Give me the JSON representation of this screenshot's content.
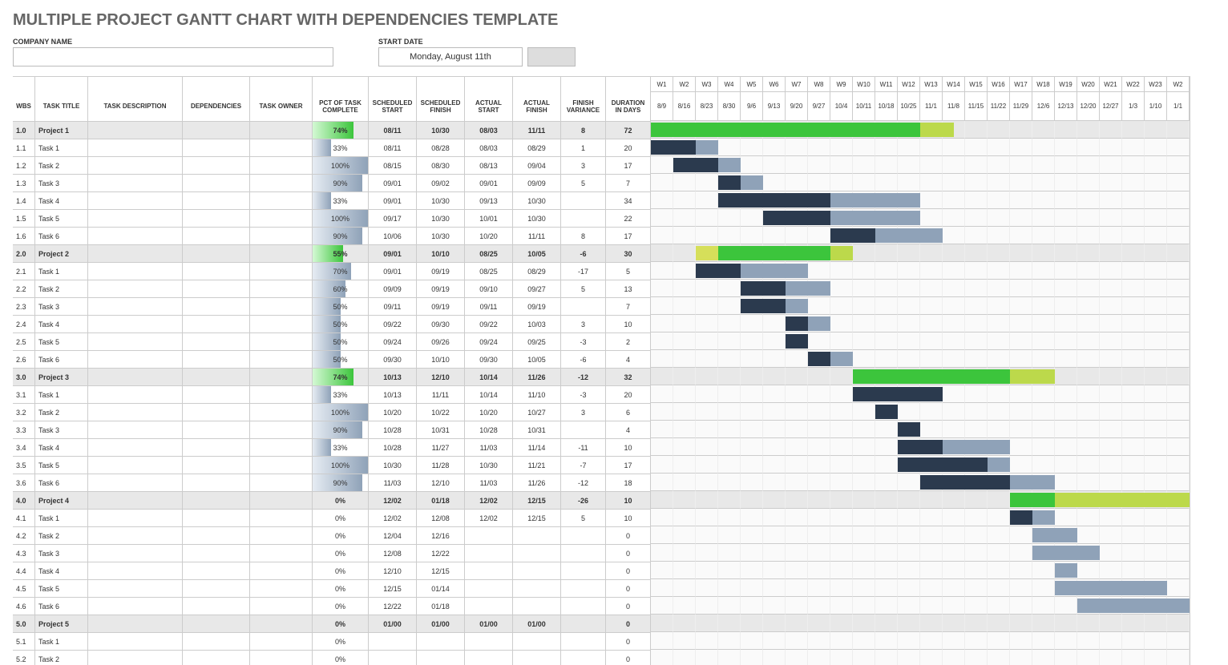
{
  "title": "MULTIPLE PROJECT GANTT CHART WITH DEPENDENCIES TEMPLATE",
  "form": {
    "company_label": "COMPANY NAME",
    "start_date_label": "START DATE",
    "start_date_value": "Monday, August 11th",
    "company_value": ""
  },
  "headers": {
    "wbs": "WBS",
    "title": "TASK TITLE",
    "desc": "TASK DESCRIPTION",
    "dep": "DEPENDENCIES",
    "owner": "TASK OWNER",
    "pct": "PCT OF TASK COMPLETE",
    "sstart": "SCHEDULED START",
    "sfinish": "SCHEDULED FINISH",
    "astart": "ACTUAL START",
    "afinish": "ACTUAL FINISH",
    "var": "FINISH VARIANCE",
    "dur": "DURATION IN DAYS"
  },
  "weeks": [
    "W1",
    "W2",
    "W3",
    "W4",
    "W5",
    "W6",
    "W7",
    "W8",
    "W9",
    "W10",
    "W11",
    "W12",
    "W13",
    "W14",
    "W15",
    "W16",
    "W17",
    "W18",
    "W19",
    "W20",
    "W21",
    "W22",
    "W23",
    "W2"
  ],
  "dates": [
    "8/9",
    "8/16",
    "8/23",
    "8/30",
    "9/6",
    "9/13",
    "9/20",
    "9/27",
    "10/4",
    "10/11",
    "10/18",
    "10/25",
    "11/1",
    "11/8",
    "11/15",
    "11/22",
    "11/29",
    "12/6",
    "12/13",
    "12/20",
    "12/27",
    "1/3",
    "1/10",
    "1/1"
  ],
  "rows": [
    {
      "wbs": "1.0",
      "title": "Project 1",
      "proj": true,
      "pct": "74%",
      "pctv": 74,
      "ss": "08/11",
      "sf": "10/30",
      "as": "08/03",
      "af": "11/11",
      "var": "8",
      "dur": "72",
      "bar": [
        0,
        12,
        1.5,
        "proj"
      ]
    },
    {
      "wbs": "1.1",
      "title": "Task 1",
      "pct": "33%",
      "pctv": 33,
      "ss": "08/11",
      "sf": "08/28",
      "as": "08/03",
      "af": "08/29",
      "var": "1",
      "dur": "20",
      "bar": [
        0,
        2,
        1,
        "task"
      ]
    },
    {
      "wbs": "1.2",
      "title": "Task 2",
      "pct": "100%",
      "pctv": 100,
      "ss": "08/15",
      "sf": "08/30",
      "as": "08/13",
      "af": "09/04",
      "var": "3",
      "dur": "17",
      "bar": [
        1,
        2,
        1,
        "task"
      ]
    },
    {
      "wbs": "1.3",
      "title": "Task 3",
      "pct": "90%",
      "pctv": 90,
      "ss": "09/01",
      "sf": "09/02",
      "as": "09/01",
      "af": "09/09",
      "var": "5",
      "dur": "7",
      "bar": [
        3,
        1,
        1,
        "task"
      ]
    },
    {
      "wbs": "1.4",
      "title": "Task 4",
      "pct": "33%",
      "pctv": 33,
      "ss": "09/01",
      "sf": "10/30",
      "as": "09/13",
      "af": "10/30",
      "var": "",
      "dur": "34",
      "bar": [
        3,
        5,
        4,
        "task"
      ]
    },
    {
      "wbs": "1.5",
      "title": "Task 5",
      "pct": "100%",
      "pctv": 100,
      "ss": "09/17",
      "sf": "10/30",
      "as": "10/01",
      "af": "10/30",
      "var": "",
      "dur": "22",
      "bar": [
        5,
        3,
        4,
        "task"
      ]
    },
    {
      "wbs": "1.6",
      "title": "Task 6",
      "pct": "90%",
      "pctv": 90,
      "ss": "10/06",
      "sf": "10/30",
      "as": "10/20",
      "af": "11/11",
      "var": "8",
      "dur": "17",
      "bar": [
        8,
        2,
        3,
        "task"
      ]
    },
    {
      "wbs": "2.0",
      "title": "Project 2",
      "proj": true,
      "pct": "55%",
      "pctv": 55,
      "ss": "09/01",
      "sf": "10/10",
      "as": "08/25",
      "af": "10/05",
      "var": "-6",
      "dur": "30",
      "bar": [
        2,
        1,
        6,
        "proj-early"
      ]
    },
    {
      "wbs": "2.1",
      "title": "Task 1",
      "pct": "70%",
      "pctv": 70,
      "ss": "09/01",
      "sf": "09/19",
      "as": "08/25",
      "af": "08/29",
      "var": "-17",
      "dur": "5",
      "bar": [
        2,
        2,
        3,
        "task"
      ]
    },
    {
      "wbs": "2.2",
      "title": "Task 2",
      "pct": "60%",
      "pctv": 60,
      "ss": "09/09",
      "sf": "09/19",
      "as": "09/10",
      "af": "09/27",
      "var": "5",
      "dur": "13",
      "bar": [
        4,
        2,
        2,
        "task"
      ]
    },
    {
      "wbs": "2.3",
      "title": "Task 3",
      "pct": "50%",
      "pctv": 50,
      "ss": "09/11",
      "sf": "09/19",
      "as": "09/11",
      "af": "09/19",
      "var": "",
      "dur": "7",
      "bar": [
        4,
        2,
        1,
        "task"
      ]
    },
    {
      "wbs": "2.4",
      "title": "Task 4",
      "pct": "50%",
      "pctv": 50,
      "ss": "09/22",
      "sf": "09/30",
      "as": "09/22",
      "af": "10/03",
      "var": "3",
      "dur": "10",
      "bar": [
        6,
        1,
        1,
        "task"
      ]
    },
    {
      "wbs": "2.5",
      "title": "Task 5",
      "pct": "50%",
      "pctv": 50,
      "ss": "09/24",
      "sf": "09/26",
      "as": "09/24",
      "af": "09/25",
      "var": "-3",
      "dur": "2",
      "bar": [
        6,
        1,
        0,
        "task"
      ]
    },
    {
      "wbs": "2.6",
      "title": "Task 6",
      "pct": "50%",
      "pctv": 50,
      "ss": "09/30",
      "sf": "10/10",
      "as": "09/30",
      "af": "10/05",
      "var": "-6",
      "dur": "4",
      "bar": [
        7,
        1,
        1,
        "task"
      ]
    },
    {
      "wbs": "3.0",
      "title": "Project 3",
      "proj": true,
      "pct": "74%",
      "pctv": 74,
      "ss": "10/13",
      "sf": "12/10",
      "as": "10/14",
      "af": "11/26",
      "var": "-12",
      "dur": "32",
      "bar": [
        9,
        7,
        2,
        "proj"
      ]
    },
    {
      "wbs": "3.1",
      "title": "Task 1",
      "pct": "33%",
      "pctv": 33,
      "ss": "10/13",
      "sf": "11/11",
      "as": "10/14",
      "af": "11/10",
      "var": "-3",
      "dur": "20",
      "bar": [
        9,
        4,
        0,
        "task"
      ]
    },
    {
      "wbs": "3.2",
      "title": "Task 2",
      "pct": "100%",
      "pctv": 100,
      "ss": "10/20",
      "sf": "10/22",
      "as": "10/20",
      "af": "10/27",
      "var": "3",
      "dur": "6",
      "bar": [
        10,
        1,
        0,
        "task"
      ]
    },
    {
      "wbs": "3.3",
      "title": "Task 3",
      "pct": "90%",
      "pctv": 90,
      "ss": "10/28",
      "sf": "10/31",
      "as": "10/28",
      "af": "10/31",
      "var": "",
      "dur": "4",
      "bar": [
        11,
        1,
        0,
        "task"
      ]
    },
    {
      "wbs": "3.4",
      "title": "Task 4",
      "pct": "33%",
      "pctv": 33,
      "ss": "10/28",
      "sf": "11/27",
      "as": "11/03",
      "af": "11/14",
      "var": "-11",
      "dur": "10",
      "bar": [
        11,
        2,
        3,
        "task"
      ]
    },
    {
      "wbs": "3.5",
      "title": "Task 5",
      "pct": "100%",
      "pctv": 100,
      "ss": "10/30",
      "sf": "11/28",
      "as": "10/30",
      "af": "11/21",
      "var": "-7",
      "dur": "17",
      "bar": [
        11,
        4,
        1,
        "task"
      ]
    },
    {
      "wbs": "3.6",
      "title": "Task 6",
      "pct": "90%",
      "pctv": 90,
      "ss": "11/03",
      "sf": "12/10",
      "as": "11/03",
      "af": "11/26",
      "var": "-12",
      "dur": "18",
      "bar": [
        12,
        4,
        2,
        "task"
      ]
    },
    {
      "wbs": "4.0",
      "title": "Project 4",
      "proj": true,
      "pct": "0%",
      "pctv": 0,
      "ss": "12/02",
      "sf": "01/18",
      "as": "12/02",
      "af": "12/15",
      "var": "-26",
      "dur": "10",
      "bar": [
        16,
        2,
        6,
        "proj"
      ]
    },
    {
      "wbs": "4.1",
      "title": "Task 1",
      "pct": "0%",
      "pctv": 0,
      "ss": "12/02",
      "sf": "12/08",
      "as": "12/02",
      "af": "12/15",
      "var": "5",
      "dur": "10",
      "bar": [
        16,
        1,
        1,
        "task"
      ]
    },
    {
      "wbs": "4.2",
      "title": "Task 2",
      "pct": "0%",
      "pctv": 0,
      "ss": "12/04",
      "sf": "12/16",
      "as": "",
      "af": "",
      "var": "",
      "dur": "0",
      "bar": [
        17,
        0,
        2,
        "task"
      ]
    },
    {
      "wbs": "4.3",
      "title": "Task 3",
      "pct": "0%",
      "pctv": 0,
      "ss": "12/08",
      "sf": "12/22",
      "as": "",
      "af": "",
      "var": "",
      "dur": "0",
      "bar": [
        17,
        0,
        3,
        "task"
      ]
    },
    {
      "wbs": "4.4",
      "title": "Task 4",
      "pct": "0%",
      "pctv": 0,
      "ss": "12/10",
      "sf": "12/15",
      "as": "",
      "af": "",
      "var": "",
      "dur": "0",
      "bar": [
        18,
        0,
        1,
        "task"
      ]
    },
    {
      "wbs": "4.5",
      "title": "Task 5",
      "pct": "0%",
      "pctv": 0,
      "ss": "12/15",
      "sf": "01/14",
      "as": "",
      "af": "",
      "var": "",
      "dur": "0",
      "bar": [
        18,
        0,
        5,
        "task"
      ]
    },
    {
      "wbs": "4.6",
      "title": "Task 6",
      "pct": "0%",
      "pctv": 0,
      "ss": "12/22",
      "sf": "01/18",
      "as": "",
      "af": "",
      "var": "",
      "dur": "0",
      "bar": [
        19,
        0,
        5,
        "task"
      ]
    },
    {
      "wbs": "5.0",
      "title": "Project 5",
      "proj": true,
      "pct": "0%",
      "pctv": 0,
      "ss": "01/00",
      "sf": "01/00",
      "as": "01/00",
      "af": "01/00",
      "var": "",
      "dur": "0",
      "bar": null
    },
    {
      "wbs": "5.1",
      "title": "Task 1",
      "pct": "0%",
      "pctv": 0,
      "ss": "",
      "sf": "",
      "as": "",
      "af": "",
      "var": "",
      "dur": "0",
      "bar": null
    },
    {
      "wbs": "5.2",
      "title": "Task 2",
      "pct": "0%",
      "pctv": 0,
      "ss": "",
      "sf": "",
      "as": "",
      "af": "",
      "var": "",
      "dur": "0",
      "bar": null
    }
  ],
  "chart_data": {
    "type": "gantt",
    "title": "Multiple Project Gantt Chart with Dependencies",
    "x_axis": {
      "unit": "week",
      "labels": [
        "W1",
        "W2",
        "W3",
        "W4",
        "W5",
        "W6",
        "W7",
        "W8",
        "W9",
        "W10",
        "W11",
        "W12",
        "W13",
        "W14",
        "W15",
        "W16",
        "W17",
        "W18",
        "W19",
        "W20",
        "W21",
        "W22",
        "W23"
      ],
      "dates": [
        "8/9",
        "8/16",
        "8/23",
        "8/30",
        "9/6",
        "9/13",
        "9/20",
        "9/27",
        "10/4",
        "10/11",
        "10/18",
        "10/25",
        "11/1",
        "11/8",
        "11/15",
        "11/22",
        "11/29",
        "12/6",
        "12/13",
        "12/20",
        "12/27",
        "1/3",
        "1/10"
      ]
    },
    "series": [
      {
        "name": "Project 1",
        "type": "summary",
        "scheduled": [
          "08/11",
          "10/30"
        ],
        "actual": [
          "08/03",
          "11/11"
        ],
        "pct_complete": 74,
        "duration_days": 72,
        "finish_variance": 8
      },
      {
        "name": "P1 Task 1",
        "scheduled": [
          "08/11",
          "08/28"
        ],
        "actual": [
          "08/03",
          "08/29"
        ],
        "pct_complete": 33,
        "duration_days": 20,
        "finish_variance": 1
      },
      {
        "name": "P1 Task 2",
        "scheduled": [
          "08/15",
          "08/30"
        ],
        "actual": [
          "08/13",
          "09/04"
        ],
        "pct_complete": 100,
        "duration_days": 17,
        "finish_variance": 3
      },
      {
        "name": "P1 Task 3",
        "scheduled": [
          "09/01",
          "09/02"
        ],
        "actual": [
          "09/01",
          "09/09"
        ],
        "pct_complete": 90,
        "duration_days": 7,
        "finish_variance": 5
      },
      {
        "name": "P1 Task 4",
        "scheduled": [
          "09/01",
          "10/30"
        ],
        "actual": [
          "09/13",
          "10/30"
        ],
        "pct_complete": 33,
        "duration_days": 34
      },
      {
        "name": "P1 Task 5",
        "scheduled": [
          "09/17",
          "10/30"
        ],
        "actual": [
          "10/01",
          "10/30"
        ],
        "pct_complete": 100,
        "duration_days": 22
      },
      {
        "name": "P1 Task 6",
        "scheduled": [
          "10/06",
          "10/30"
        ],
        "actual": [
          "10/20",
          "11/11"
        ],
        "pct_complete": 90,
        "duration_days": 17,
        "finish_variance": 8
      },
      {
        "name": "Project 2",
        "type": "summary",
        "scheduled": [
          "09/01",
          "10/10"
        ],
        "actual": [
          "08/25",
          "10/05"
        ],
        "pct_complete": 55,
        "duration_days": 30,
        "finish_variance": -6
      },
      {
        "name": "P2 Task 1",
        "scheduled": [
          "09/01",
          "09/19"
        ],
        "actual": [
          "08/25",
          "08/29"
        ],
        "pct_complete": 70,
        "duration_days": 5,
        "finish_variance": -17
      },
      {
        "name": "P2 Task 2",
        "scheduled": [
          "09/09",
          "09/19"
        ],
        "actual": [
          "09/10",
          "09/27"
        ],
        "pct_complete": 60,
        "duration_days": 13,
        "finish_variance": 5
      },
      {
        "name": "P2 Task 3",
        "scheduled": [
          "09/11",
          "09/19"
        ],
        "actual": [
          "09/11",
          "09/19"
        ],
        "pct_complete": 50,
        "duration_days": 7
      },
      {
        "name": "P2 Task 4",
        "scheduled": [
          "09/22",
          "09/30"
        ],
        "actual": [
          "09/22",
          "10/03"
        ],
        "pct_complete": 50,
        "duration_days": 10,
        "finish_variance": 3
      },
      {
        "name": "P2 Task 5",
        "scheduled": [
          "09/24",
          "09/26"
        ],
        "actual": [
          "09/24",
          "09/25"
        ],
        "pct_complete": 50,
        "duration_days": 2,
        "finish_variance": -3
      },
      {
        "name": "P2 Task 6",
        "scheduled": [
          "09/30",
          "10/10"
        ],
        "actual": [
          "09/30",
          "10/05"
        ],
        "pct_complete": 50,
        "duration_days": 4,
        "finish_variance": -6
      },
      {
        "name": "Project 3",
        "type": "summary",
        "scheduled": [
          "10/13",
          "12/10"
        ],
        "actual": [
          "10/14",
          "11/26"
        ],
        "pct_complete": 74,
        "duration_days": 32,
        "finish_variance": -12
      },
      {
        "name": "P3 Task 1",
        "scheduled": [
          "10/13",
          "11/11"
        ],
        "actual": [
          "10/14",
          "11/10"
        ],
        "pct_complete": 33,
        "duration_days": 20,
        "finish_variance": -3
      },
      {
        "name": "P3 Task 2",
        "scheduled": [
          "10/20",
          "10/22"
        ],
        "actual": [
          "10/20",
          "10/27"
        ],
        "pct_complete": 100,
        "duration_days": 6,
        "finish_variance": 3
      },
      {
        "name": "P3 Task 3",
        "scheduled": [
          "10/28",
          "10/31"
        ],
        "actual": [
          "10/28",
          "10/31"
        ],
        "pct_complete": 90,
        "duration_days": 4
      },
      {
        "name": "P3 Task 4",
        "scheduled": [
          "10/28",
          "11/27"
        ],
        "actual": [
          "11/03",
          "11/14"
        ],
        "pct_complete": 33,
        "duration_days": 10,
        "finish_variance": -11
      },
      {
        "name": "P3 Task 5",
        "scheduled": [
          "10/30",
          "11/28"
        ],
        "actual": [
          "10/30",
          "11/21"
        ],
        "pct_complete": 100,
        "duration_days": 17,
        "finish_variance": -7
      },
      {
        "name": "P3 Task 6",
        "scheduled": [
          "11/03",
          "12/10"
        ],
        "actual": [
          "11/03",
          "11/26"
        ],
        "pct_complete": 90,
        "duration_days": 18,
        "finish_variance": -12
      },
      {
        "name": "Project 4",
        "type": "summary",
        "scheduled": [
          "12/02",
          "01/18"
        ],
        "actual": [
          "12/02",
          "12/15"
        ],
        "pct_complete": 0,
        "duration_days": 10,
        "finish_variance": -26
      },
      {
        "name": "P4 Task 1",
        "scheduled": [
          "12/02",
          "12/08"
        ],
        "actual": [
          "12/02",
          "12/15"
        ],
        "pct_complete": 0,
        "duration_days": 10,
        "finish_variance": 5
      },
      {
        "name": "P4 Task 2",
        "scheduled": [
          "12/04",
          "12/16"
        ],
        "pct_complete": 0,
        "duration_days": 0
      },
      {
        "name": "P4 Task 3",
        "scheduled": [
          "12/08",
          "12/22"
        ],
        "pct_complete": 0,
        "duration_days": 0
      },
      {
        "name": "P4 Task 4",
        "scheduled": [
          "12/10",
          "12/15"
        ],
        "pct_complete": 0,
        "duration_days": 0
      },
      {
        "name": "P4 Task 5",
        "scheduled": [
          "12/15",
          "01/14"
        ],
        "pct_complete": 0,
        "duration_days": 0
      },
      {
        "name": "P4 Task 6",
        "scheduled": [
          "12/22",
          "01/18"
        ],
        "pct_complete": 0,
        "duration_days": 0
      },
      {
        "name": "Project 5",
        "type": "summary",
        "pct_complete": 0,
        "duration_days": 0
      }
    ]
  }
}
